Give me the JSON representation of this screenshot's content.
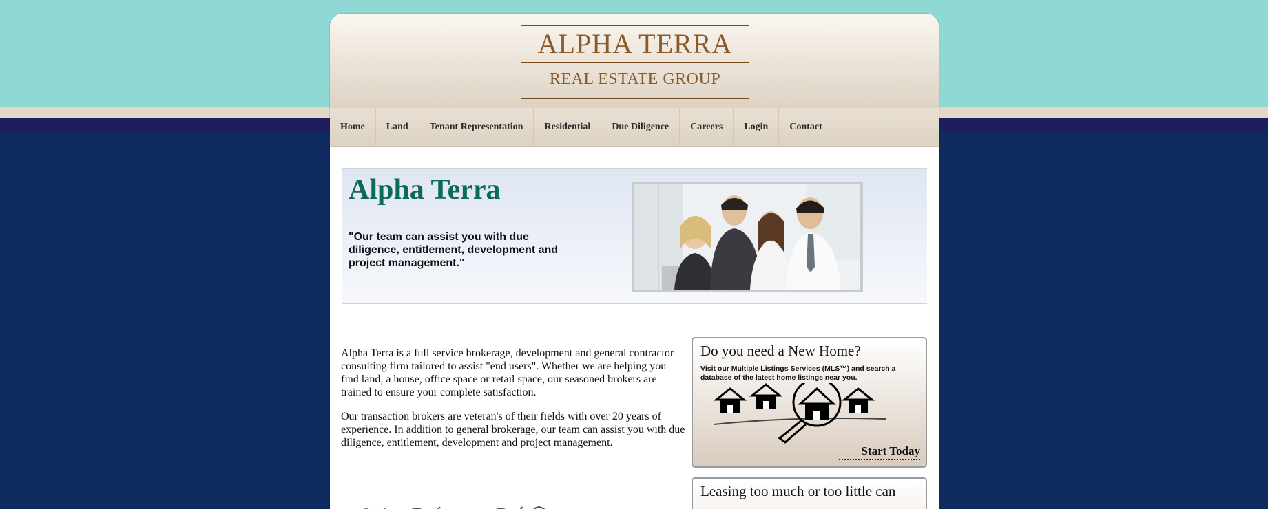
{
  "logo": {
    "name": "ALPHA TERRA",
    "tagline": "REAL ESTATE GROUP"
  },
  "nav": {
    "items": [
      {
        "label": "Home"
      },
      {
        "label": "Land"
      },
      {
        "label": "Tenant Representation"
      },
      {
        "label": "Residential"
      },
      {
        "label": "Due Diligence"
      },
      {
        "label": "Careers"
      },
      {
        "label": "Login"
      },
      {
        "label": "Contact"
      }
    ]
  },
  "hero": {
    "title": "Alpha Terra",
    "quote": "\"Our team can assist you with due diligence, entitlement, development and project management.\""
  },
  "content": {
    "paragraph1": "Alpha Terra is a full service brokerage, development and general contractor consulting firm tailored to assist \"end users\". Whether we are helping you find land, a house, office space or retail space, our seasoned brokers are trained to ensure your complete satisfaction.",
    "paragraph2": "Our transaction brokers are veteran's of their fields with over 20 years of experience. In addition to general brokerage, our team can assist you with due diligence, entitlement, development and project management."
  },
  "promo_home": {
    "title": "Do you need a New Home?",
    "text": "Visit our Multiple Listings Services (MLS™) and search a database of the latest home listings near you.",
    "cta": "Start Today"
  },
  "promo_leasing": {
    "title": "Leasing too much or too little can"
  },
  "colors": {
    "brand_brown": "#8a5a2a",
    "hero_title_green": "#0c6a58",
    "top_band_teal": "#8fd8d4",
    "page_navy": "#0e2a5e"
  }
}
